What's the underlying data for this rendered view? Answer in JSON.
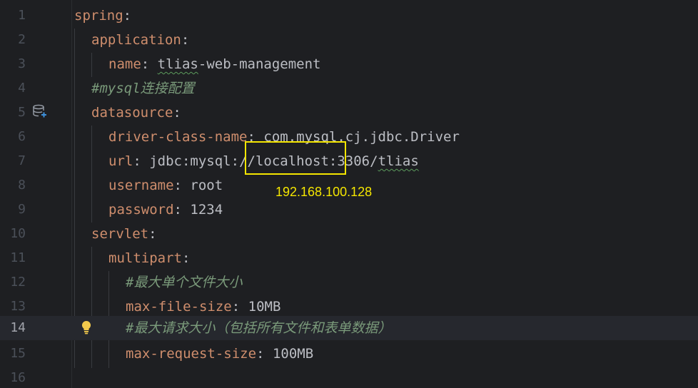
{
  "lines": [
    {
      "number": "1",
      "key": "spring"
    },
    {
      "number": "2",
      "key": "application"
    },
    {
      "number": "3",
      "key": "name",
      "value_part1": "tlias",
      "value_part2": "-web-management"
    },
    {
      "number": "4",
      "comment": "#mysql连接配置"
    },
    {
      "number": "5",
      "key": "datasource"
    },
    {
      "number": "6",
      "key": "driver-class-name",
      "value_part1": "com.mysql.cj.jdbc.Driver"
    },
    {
      "number": "7",
      "key": "url",
      "value_part1": "jdbc:mysql:",
      "value_part2": "//localhost:",
      "value_part3": "3306/",
      "value_part4": "tlias"
    },
    {
      "number": "8",
      "key": "username",
      "value_part1": "root"
    },
    {
      "number": "9",
      "key": "password",
      "value_part1": "1234"
    },
    {
      "number": "10",
      "key": "servlet"
    },
    {
      "number": "11",
      "key": "multipart"
    },
    {
      "number": "12",
      "comment": "#最大单个文件大小"
    },
    {
      "number": "13",
      "key": "max-file-size",
      "value_part1": "10MB"
    },
    {
      "number": "14",
      "comment": "#最大请求大小（包括所有文件和表单数据）"
    },
    {
      "number": "15",
      "key": "max-request-size",
      "value_part1": "100MB"
    },
    {
      "number": "16"
    }
  ],
  "colon": ":",
  "annotation": "192.168.100.128",
  "current_line": "14",
  "icons": {
    "line5": "database-icon",
    "line14": "lightbulb-icon"
  },
  "colors": {
    "background": "#1e1f22",
    "key": "#cf8e6d",
    "comment": "#7a9a7a",
    "highlight": "#f5e600"
  }
}
